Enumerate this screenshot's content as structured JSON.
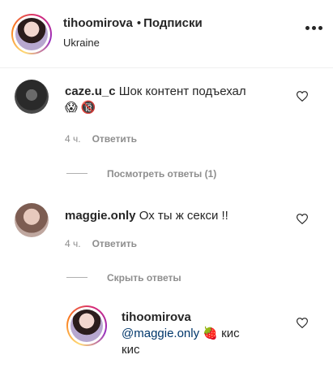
{
  "header": {
    "username": "tihoomirova",
    "separator": "•",
    "follow_label": "Подписки",
    "location": "Ukraine"
  },
  "comments": [
    {
      "username": "caze.u_c",
      "text": "Шок контент подъехал",
      "emoji_1": "😱",
      "emoji_2": "🔞",
      "time": "4 ч.",
      "reply_label": "Ответить",
      "replies_toggle": "Посмотреть ответы (1)"
    },
    {
      "username": "maggie.only",
      "text": "Ох ты ж секси !!",
      "time": "4 ч.",
      "reply_label": "Ответить",
      "replies_toggle": "Скрыть ответы",
      "replies": [
        {
          "username": "tihoomirova",
          "mention": "@maggie.only",
          "emoji": "🍓",
          "text_line1": "кис",
          "text_line2": "кис"
        }
      ]
    }
  ],
  "icons": {
    "like": "heart-outline-icon",
    "more": "more-horizontal-icon",
    "accent_link": "#00376b",
    "muted": "#8e8e8e"
  }
}
